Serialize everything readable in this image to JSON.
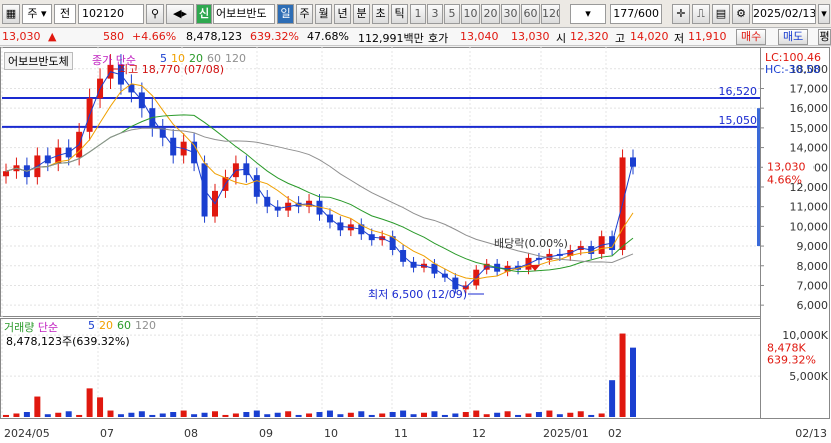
{
  "toolbar": {
    "market_type": "주",
    "market_all": "전",
    "code": "102120",
    "search_icon": "search-icon",
    "sound_icon": "speaker-icon",
    "new_badge": "신",
    "stock_name": "어보브반도",
    "periods": [
      "일",
      "주",
      "월",
      "년",
      "분",
      "초",
      "틱"
    ],
    "active_period": "일",
    "intervals": [
      "1",
      "3",
      "5",
      "10",
      "20",
      "30",
      "60",
      "120"
    ],
    "count": "177",
    "count_max": "/600",
    "date": "2025/02/13"
  },
  "quote": {
    "price": "13,030",
    "change_arrow": "▲",
    "change": "580",
    "change_pct": "+4.66%",
    "volume": "8,478,123",
    "volume_pct": "639.32%",
    "ratio": "47.68%",
    "amount": "112,991백만",
    "ask_label": "호가",
    "ask": "13,040",
    "bid": "13,030",
    "open_label": "시",
    "open": "12,320",
    "high_label": "고",
    "high": "14,020",
    "low_label": "저",
    "low": "11,910",
    "buy_button": "매수",
    "sell_button": "매도",
    "hold_button": "평"
  },
  "price_chart": {
    "title": "어보브반도체",
    "ma_label": "종가 단순",
    "ma_periods": [
      "5",
      "10",
      "20",
      "60",
      "120"
    ],
    "ma_colors": [
      "#1a3fd0",
      "#f0a000",
      "#2a9a2a",
      "#909090"
    ],
    "high_marker": "최고 18,770 (07/08)",
    "low_marker": "최저 6,500 (12/09)",
    "dividend_marker": "배당락(0.00%)",
    "line1_label": "16,520",
    "line2_label": "15,050",
    "lc": "LC:100.46",
    "hc": "HC:-30.58",
    "current_price_tag": "13,030",
    "current_pct_tag": "4.66%",
    "y_ticks": [
      "18,000",
      "17,000",
      "16,000",
      "15,000",
      "14,000",
      "13,000",
      "12,000",
      "11,000",
      "10,000",
      "9,000",
      "8,000",
      "7,000",
      "6,000"
    ]
  },
  "volume_chart": {
    "title": "거래량",
    "ma_label": "단순",
    "ma_periods": [
      "5",
      "20",
      "60",
      "120"
    ],
    "value_text": "8,478,123주(639.32%)",
    "tag_value": "8,478K",
    "tag_pct": "639.32%",
    "y_ticks": [
      "10,000K",
      "5,000K"
    ]
  },
  "x_axis": {
    "labels": [
      "2024/05",
      "07",
      "08",
      "09",
      "10",
      "11",
      "12",
      "2025/01",
      "02"
    ],
    "right_label": "02/13"
  },
  "chart_data": {
    "type": "candlestick",
    "ylim": [
      5500,
      18700
    ],
    "horizontal_lines": [
      16520,
      15050
    ],
    "high": {
      "value": 18770,
      "date": "07/08"
    },
    "low": {
      "value": 6500,
      "date": "12/09"
    },
    "last_close": 13030,
    "close_series": [
      12800,
      13100,
      12500,
      13600,
      13200,
      14000,
      13500,
      14800,
      16500,
      17500,
      18200,
      17200,
      16800,
      16000,
      15000,
      14500,
      13600,
      14300,
      13200,
      10500,
      11800,
      12500,
      13200,
      12600,
      11500,
      11000,
      10800,
      11200,
      11000,
      11300,
      10600,
      10200,
      9800,
      10100,
      9600,
      9300,
      9500,
      8800,
      8200,
      7900,
      8100,
      7600,
      7400,
      6800,
      7000,
      7800,
      8100,
      7700,
      8000,
      7800,
      8400,
      8300,
      8600,
      8500,
      8800,
      9000,
      8600,
      9500,
      8800,
      13500,
      13030
    ],
    "volume_ylim_k": [
      0,
      11000
    ],
    "last_volume_k": 8478
  }
}
